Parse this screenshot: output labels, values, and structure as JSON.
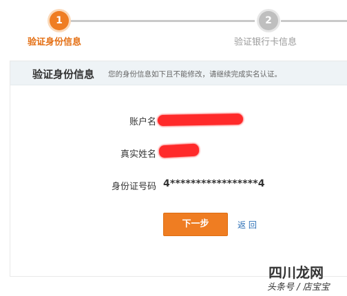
{
  "stepper": {
    "steps": [
      {
        "number": "1",
        "label": "验证身份信息",
        "state": "active",
        "color": "#ef7d22"
      },
      {
        "number": "2",
        "label": "验证银行卡信息",
        "state": "pending",
        "color": "#bfbfbf"
      }
    ]
  },
  "panel": {
    "title": "验证身份信息",
    "note": "您的身份信息如下且不能修改，请继续完成实名认证。",
    "fields": {
      "account": {
        "label": "账户名"
      },
      "realname": {
        "label": "真实姓名"
      },
      "idnumber": {
        "label": "身份证号码",
        "value": "4*****************4"
      }
    }
  },
  "actions": {
    "next_label": "下一步",
    "back_label": "返 回",
    "accent_color": "#ef7d22",
    "link_color": "#2b6fb6"
  },
  "watermark": {
    "line1": "四川龙网",
    "line2": "头条号 / 店宝宝"
  }
}
